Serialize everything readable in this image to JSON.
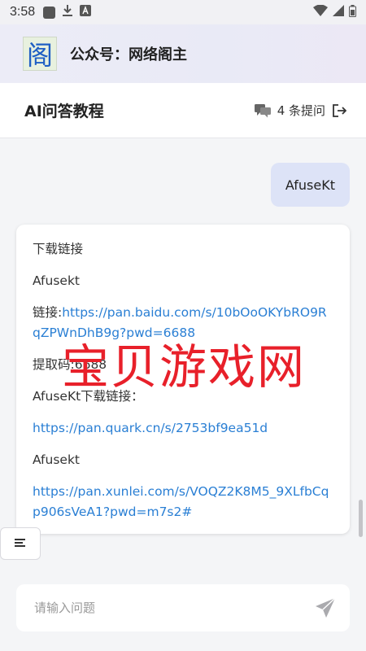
{
  "status_bar": {
    "time": "3:58",
    "icons": [
      "app-square-icon",
      "download-icon",
      "app-a-icon",
      "wifi-icon",
      "signal-icon",
      "battery-icon"
    ]
  },
  "banner": {
    "logo_char": "阁",
    "title": "公众号：网络阁主"
  },
  "header": {
    "title": "AI问答教程",
    "question_count": "4 条提问"
  },
  "chat": {
    "user_message": "AfuseKt",
    "answer": {
      "heading": "下载链接",
      "name1": "Afusekt",
      "link_prefix": "链接:",
      "baidu_link": "https://pan.baidu.com/s/10bOoOKYbRO9RqZPWnDhB9g?pwd=6688",
      "code_text": "提取码:6688",
      "quark_heading": "AfuseKt下载链接：",
      "quark_link": "https://pan.quark.cn/s/2753bf9ea51d",
      "name2": "Afusekt",
      "xunlei_link": "https://pan.xunlei.com/s/VOQZ2K8M5_9XLfbCqp906sVeA1?pwd=m7s2#"
    },
    "watermark": "宝贝游戏网"
  },
  "input": {
    "placeholder": "请输入问题"
  },
  "colors": {
    "link": "#2a7fd4",
    "user_bubble": "#dde3f7",
    "watermark": "#e8202a"
  }
}
